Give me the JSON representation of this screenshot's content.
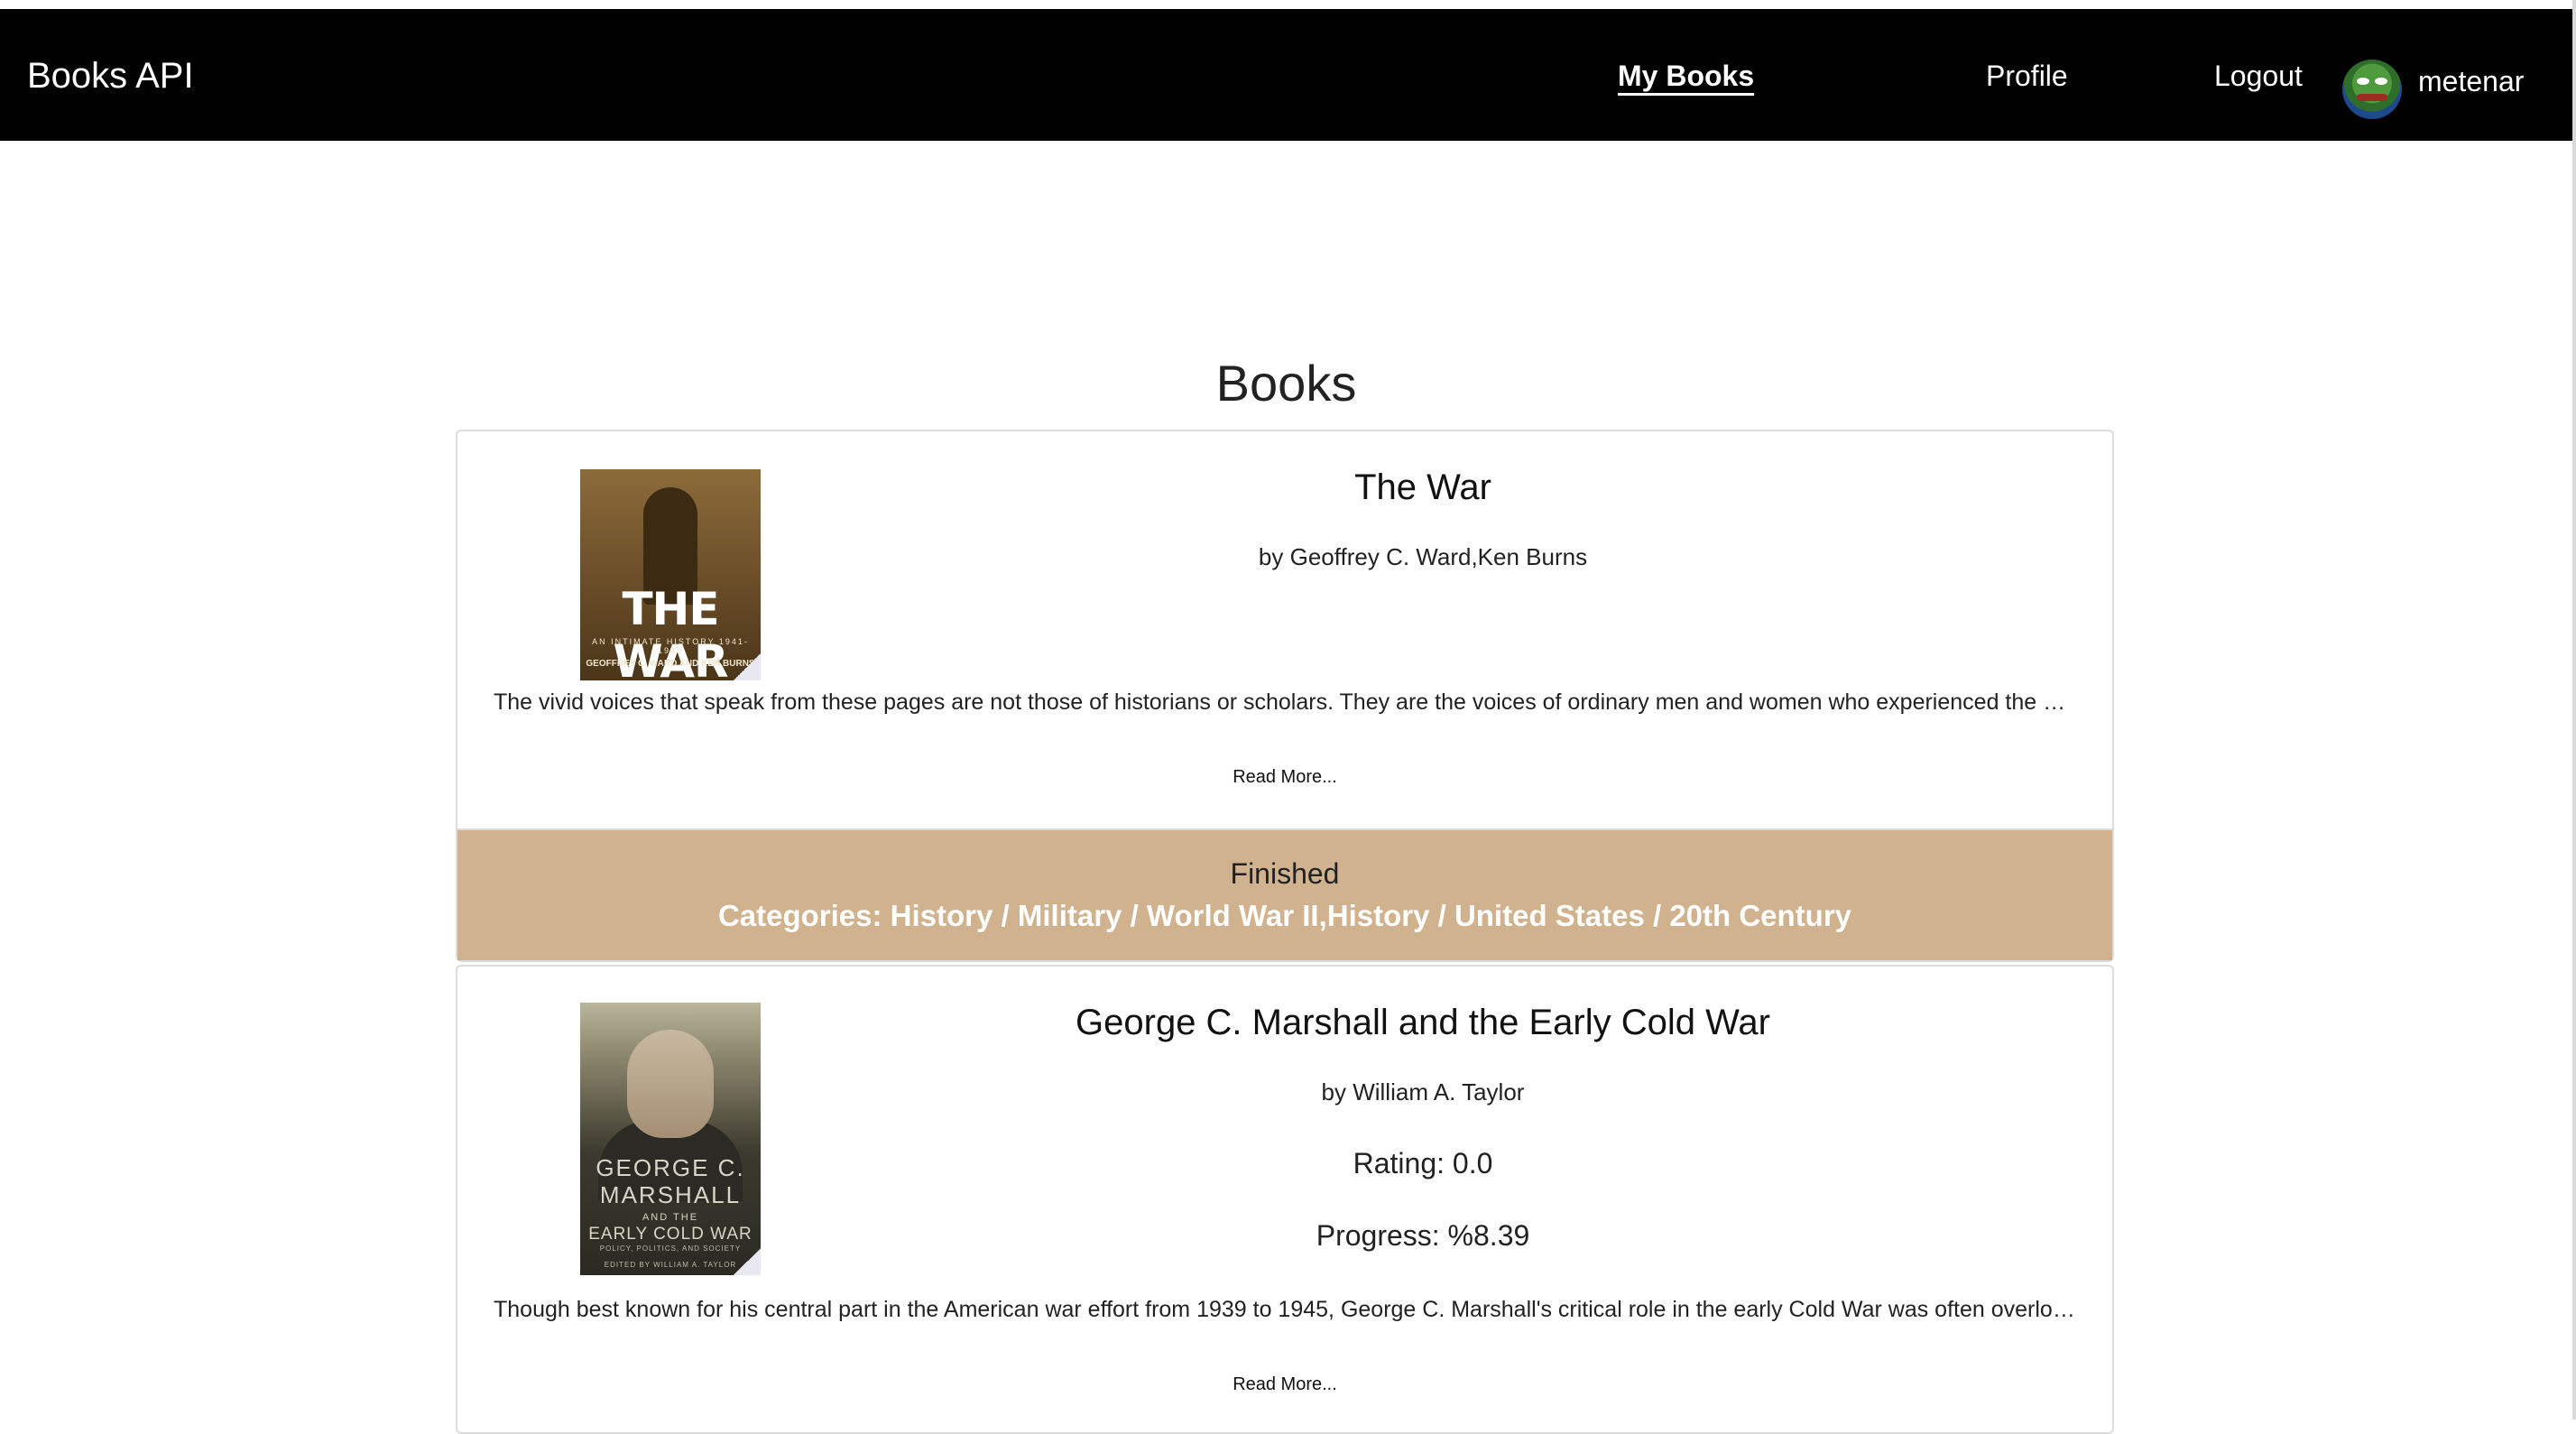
{
  "navbar": {
    "brand": "Books API",
    "links": [
      {
        "label": "My Books",
        "active": true
      },
      {
        "label": "Profile",
        "active": false
      },
      {
        "label": "Logout",
        "active": false
      }
    ],
    "username": "metenar",
    "colors": {
      "background": "#000000",
      "text": "#ffffff"
    }
  },
  "page": {
    "title": "Books"
  },
  "books": [
    {
      "title": "The War",
      "author": "by Geoffrey C. Ward,Ken Burns",
      "description": "The vivid voices that speak from these pages are not those of historians or scholars. They are the voices of ordinary men and women who experienced the war",
      "read_more": "Read More...",
      "status": "Finished",
      "categories": "Categories: History / Military / World War II,History / United States / 20th Century",
      "cover": {
        "title_text": "THE WAR",
        "subtitle_text": "AN INTIMATE HISTORY 1941-1945",
        "authors_text": "GEOFFREY C. WARD AND KEN BURNS"
      }
    },
    {
      "title": "George C. Marshall and the Early Cold War",
      "author": "by William A. Taylor",
      "rating": "Rating: 0.0",
      "progress": "Progress: %8.39",
      "description": "Though best known for his central part in the American war effort from 1939 to 1945, George C. Marshall's critical role in the early Cold War was often overlooked",
      "read_more": "Read More...",
      "cover": {
        "line1": "GEORGE C.",
        "line2": "MARSHALL",
        "line3": "AND THE",
        "line4": "EARLY COLD WAR",
        "line5": "POLICY, POLITICS, AND SOCIETY",
        "line6": "EDITED BY WILLIAM A. TAYLOR"
      }
    }
  ],
  "colors": {
    "footer_background": "#d1b28e",
    "categories_text": "#ffffff"
  }
}
